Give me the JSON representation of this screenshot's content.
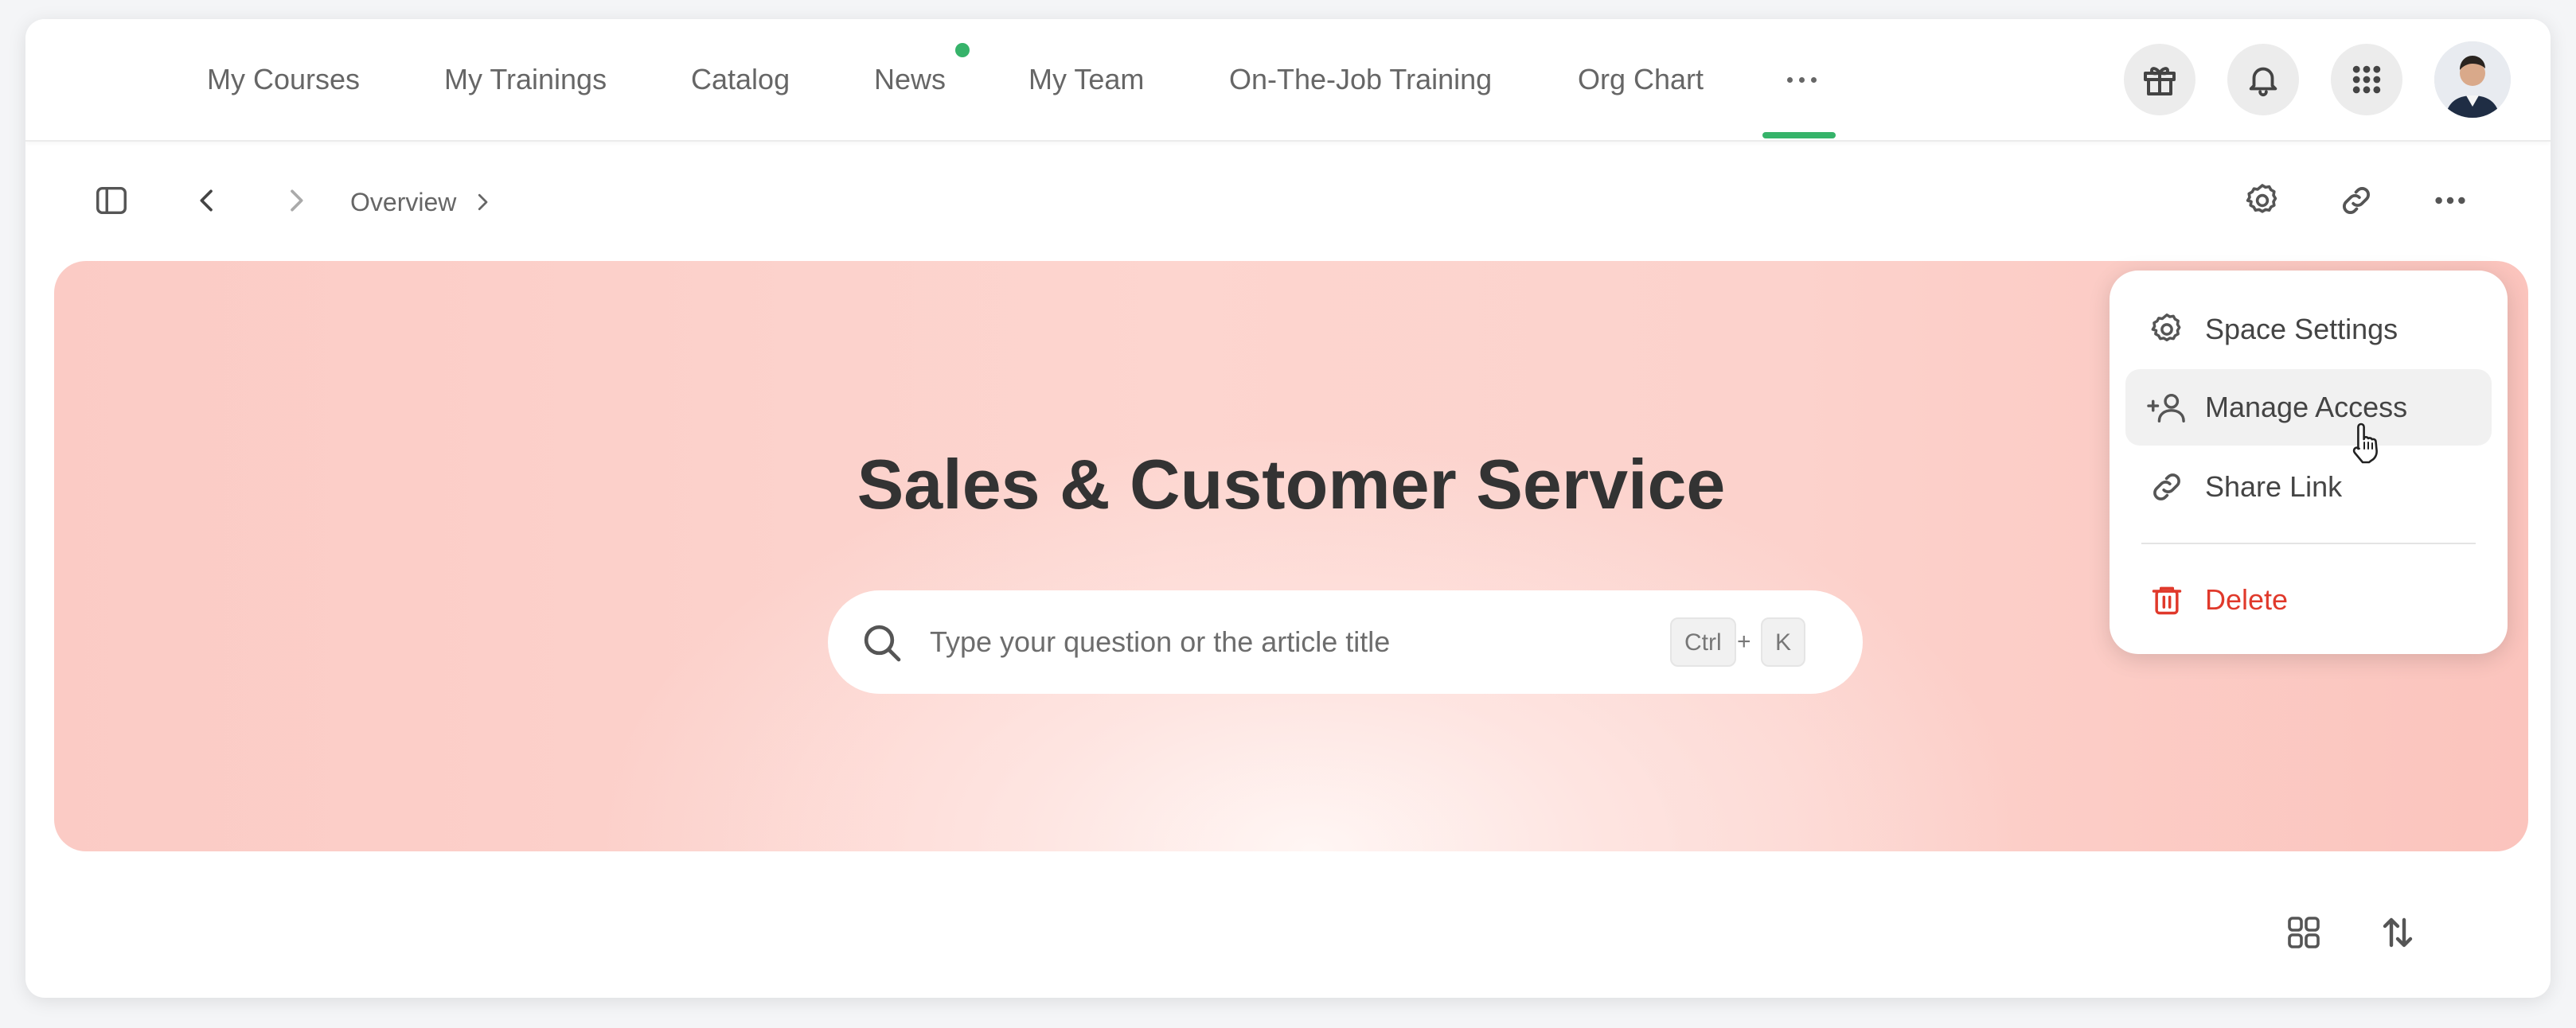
{
  "topnav": {
    "items": [
      {
        "label": "My Courses"
      },
      {
        "label": "My Trainings"
      },
      {
        "label": "Catalog"
      },
      {
        "label": "News"
      },
      {
        "label": "My Team"
      },
      {
        "label": "On-The-Job Training"
      },
      {
        "label": "Org Chart"
      }
    ],
    "more_icon": "ellipsis-icon",
    "actions": [
      "gift-icon",
      "bell-icon",
      "apps-grid-icon"
    ],
    "news_indicator_color": "#36b36a",
    "active_underline_color": "#36b36a"
  },
  "toolbar": {
    "breadcrumb": "Overview",
    "left_icons": [
      "sidebar-toggle-icon",
      "chevron-left-icon",
      "chevron-right-icon"
    ],
    "right_icons": [
      "settings-icon",
      "link-icon",
      "more-icon"
    ]
  },
  "hero": {
    "title": "Sales & Customer Service",
    "search": {
      "placeholder": "Type your question or the article title",
      "shortcut_key1": "Ctrl",
      "shortcut_plus": "+",
      "shortcut_key2": "K"
    }
  },
  "dropdown": {
    "items": [
      {
        "label": "Space Settings",
        "icon": "settings-icon"
      },
      {
        "label": "Manage Access",
        "icon": "add-user-icon"
      },
      {
        "label": "Share Link",
        "icon": "link-icon"
      },
      {
        "label": "Delete",
        "icon": "trash-icon"
      }
    ],
    "danger_color": "#e0392b"
  },
  "bottom_toolbar": {
    "icons": [
      "grid-view-icon",
      "sort-icon"
    ]
  }
}
